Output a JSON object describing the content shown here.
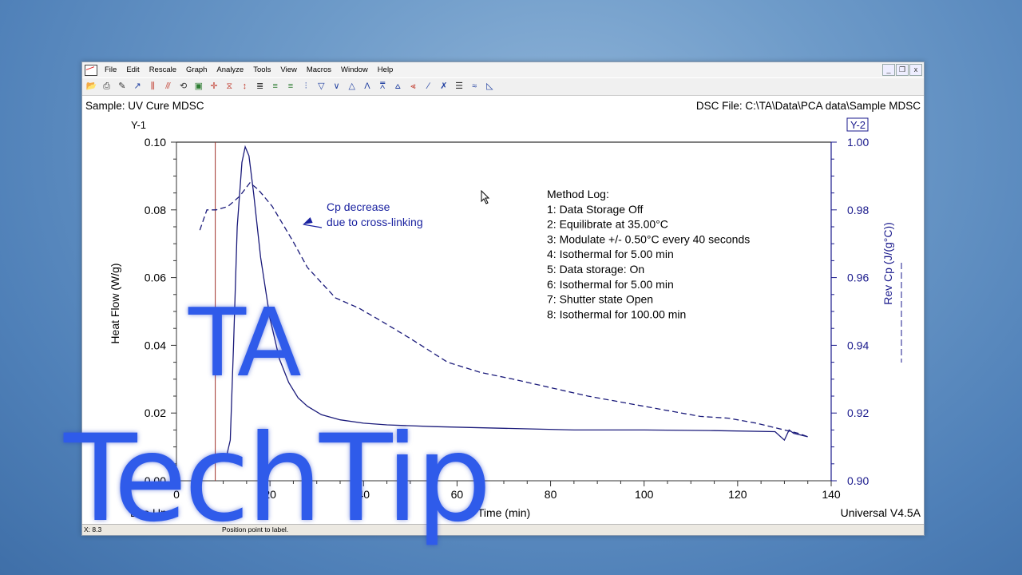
{
  "window": {
    "menu": [
      "File",
      "Edit",
      "Rescale",
      "Graph",
      "Analyze",
      "Tools",
      "View",
      "Macros",
      "Window",
      "Help"
    ],
    "controls": {
      "minimize": "_",
      "restore": "❐",
      "close": "x"
    },
    "toolbar_icons": [
      "open-icon",
      "print-icon",
      "pencil-icon",
      "data-plot-icon",
      "rescale-x-icon",
      "rescale-y-icon",
      "overlay-icon",
      "export-icon",
      "cursor-cross-icon",
      "hourglass-icon",
      "thermometer-icon",
      "baseline-icon",
      "auto-analyze-icon",
      "analyze-icon",
      "signal-change-icon",
      "peak-down-icon",
      "peak-down-alt-icon",
      "peak-up-icon",
      "peak-up-alt-icon",
      "glass-transition-icon",
      "step-transition-icon",
      "onset-icon",
      "slope-icon",
      "crossover-icon",
      "report-icon",
      "smooth-icon",
      "ruler-icon"
    ]
  },
  "header": {
    "sample": "Sample: UV Cure MDSC",
    "dsc_file": "DSC File: C:\\TA\\Data\\PCA data\\Sample MDSC"
  },
  "status": {
    "x_readout": "X: 8.3",
    "message": "Position point to label."
  },
  "overlay": {
    "line1": "TA",
    "line2": "TechTip"
  },
  "colors": {
    "series": "#1a1a7a",
    "axis_right": "#1a1a8c",
    "marker": "#a0302a",
    "annotation": "#1a22a0"
  },
  "chart_data": {
    "type": "line",
    "title": "",
    "xlabel": "Time (min)",
    "xlim": [
      0,
      140
    ],
    "xticks": [
      0,
      20,
      40,
      60,
      80,
      100,
      120,
      140
    ],
    "y1": {
      "axis_title": "Y-1",
      "label": "Heat Flow (W/g)",
      "ylim": [
        0,
        0.1
      ],
      "ticks": [
        "0.00",
        "0.02",
        "0.04",
        "0.06",
        "0.08",
        "0.10"
      ]
    },
    "y2": {
      "axis_title": "Y-2",
      "label": "Rev Cp (J/(g°C))",
      "ylim": [
        0.9,
        1.0
      ],
      "ticks": [
        "0.90",
        "0.92",
        "0.94",
        "0.96",
        "0.98",
        "1.00"
      ]
    },
    "corner_left": "Exo Up",
    "corner_right": "Universal V4.5A",
    "marker_x": 8.3,
    "grid": false,
    "series": [
      {
        "name": "Heat Flow",
        "axis": "y1",
        "style": "solid",
        "x": [
          6,
          8.5,
          10.5,
          11.5,
          12.2,
          13,
          14,
          14.7,
          15.5,
          16.5,
          18,
          20,
          22,
          24,
          26,
          28,
          31,
          35,
          40,
          45,
          55,
          70,
          85,
          100,
          115,
          128,
          130,
          131,
          132,
          135
        ],
        "y": [
          0.004,
          0.0055,
          0.006,
          0.012,
          0.04,
          0.075,
          0.094,
          0.0986,
          0.096,
          0.085,
          0.066,
          0.048,
          0.036,
          0.029,
          0.0245,
          0.022,
          0.0195,
          0.018,
          0.017,
          0.0165,
          0.016,
          0.0155,
          0.015,
          0.015,
          0.0148,
          0.0145,
          0.012,
          0.015,
          0.014,
          0.013
        ]
      },
      {
        "name": "Rev Cp",
        "axis": "y2",
        "style": "dashed",
        "x": [
          5,
          6.5,
          8.5,
          11,
          13.5,
          15.7,
          17.5,
          20.5,
          24.8,
          28,
          34,
          39,
          44,
          50,
          58,
          65,
          72,
          80,
          88,
          96,
          104,
          112,
          118,
          124,
          130,
          133,
          135
        ],
        "y": [
          0.974,
          0.98,
          0.98,
          0.981,
          0.984,
          0.988,
          0.986,
          0.981,
          0.971,
          0.963,
          0.954,
          0.951,
          0.947,
          0.942,
          0.935,
          0.932,
          0.93,
          0.9275,
          0.925,
          0.923,
          0.921,
          0.919,
          0.9185,
          0.917,
          0.915,
          0.914,
          0.913
        ]
      }
    ],
    "annotations": [
      {
        "text": [
          "Cp decrease",
          "due to cross-linking"
        ],
        "arrow_to": {
          "x": 24,
          "y2": 0.971
        }
      },
      {
        "text": [
          "Method Log:",
          "1: Data Storage Off",
          "2: Equilibrate at 35.00°C",
          "3: Modulate +/- 0.50°C every 40 seconds",
          "4: Isothermal for 5.00 min",
          "5: Data storage: On",
          "6: Isothermal for 5.00 min",
          "7: Shutter state Open",
          "8: Isothermal for 100.00 min"
        ]
      }
    ]
  }
}
